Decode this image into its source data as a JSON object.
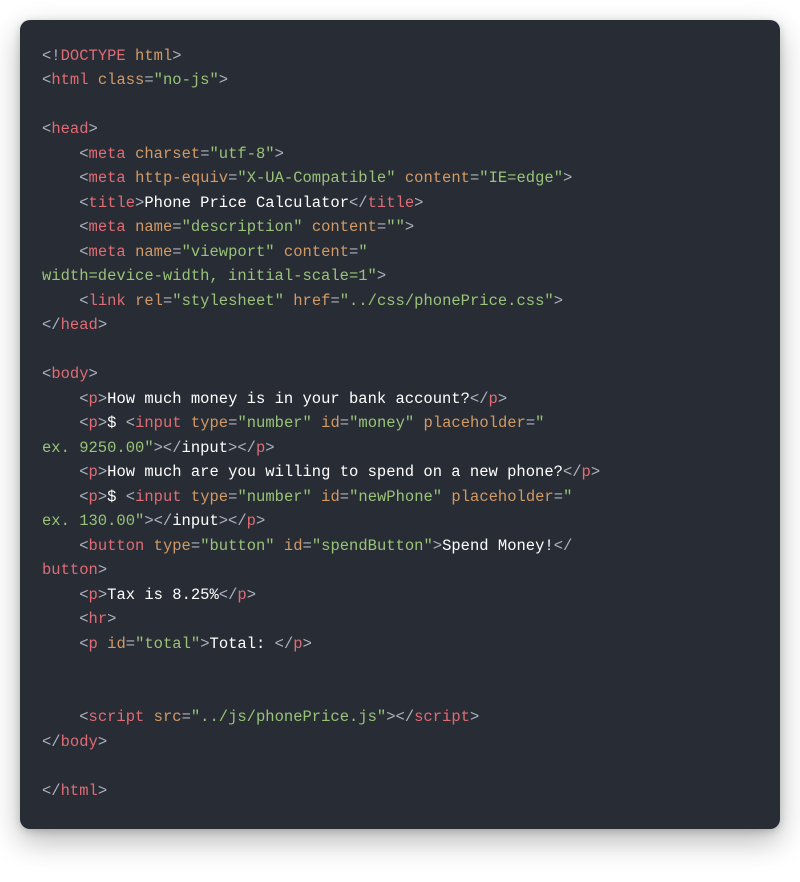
{
  "code": {
    "doctype": "<!DOCTYPE html>",
    "html_open": "html",
    "html_open_attr_name": "class",
    "html_open_attr_val": "\"no-js\"",
    "head_open": "head",
    "meta1_attr": "charset",
    "meta1_val": "\"utf-8\"",
    "meta2_attr1": "http-equiv",
    "meta2_val1": "\"X-UA-Compatible\"",
    "meta2_attr2": "content",
    "meta2_val2": "\"IE=edge\"",
    "title_tag": "title",
    "title_text": "Phone Price Calculator",
    "meta3_attr1": "name",
    "meta3_val1": "\"description\"",
    "meta3_attr2": "content",
    "meta3_val2": "\"\"",
    "meta4_attr1": "name",
    "meta4_val1": "\"viewport\"",
    "meta4_attr2": "content",
    "meta4_val2_a": "\"",
    "meta4_val2_b": "width=device-width, initial-scale=1\"",
    "link_tag": "link",
    "link_attr1": "rel",
    "link_val1": "\"stylesheet\"",
    "link_attr2": "href",
    "link_val2": "\"../css/phonePrice.css\"",
    "head_close": "head",
    "body_open": "body",
    "p_tag": "p",
    "q1": "How much money is in your bank account?",
    "dollar": "$ ",
    "input_tag": "input",
    "type_attr": "type",
    "type_number": "\"number\"",
    "id_attr": "id",
    "id_money": "\"money\"",
    "ph_attr": "placeholder",
    "ph1_a": "\"",
    "ph1_b": "ex. 9250.00\"",
    "q2": "How much are you willing to spend on a new phone?",
    "id_newPhone": "\"newPhone\"",
    "ph2_a": "\"",
    "ph2_b": "ex. 130.00\"",
    "button_tag": "button",
    "btn_type": "\"button\"",
    "btn_id": "\"spendButton\"",
    "btn_text": "Spend Money!",
    "tax_text": "Tax is 8.25%",
    "hr_tag": "hr",
    "total_id": "\"total\"",
    "total_text": "Total: ",
    "script_tag": "script",
    "src_attr": "src",
    "src_val": "\"../js/phonePrice.js\"",
    "body_close": "body",
    "html_close": "html",
    "meta_tag": "meta"
  }
}
